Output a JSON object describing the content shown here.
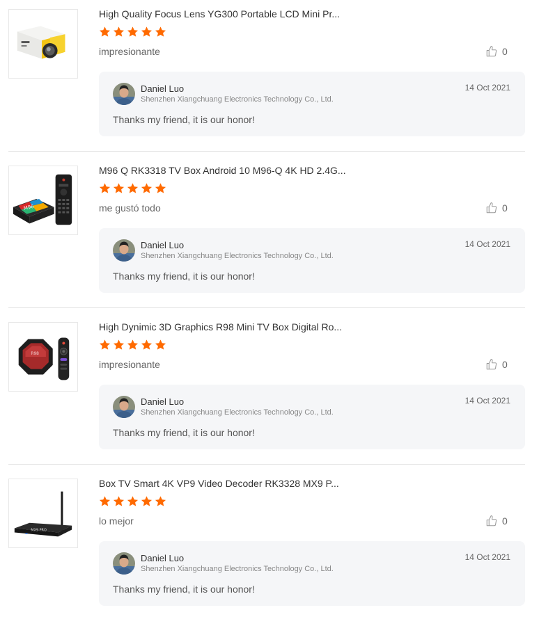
{
  "colors": {
    "star": "#ff6a00",
    "reply_bg": "#f5f6f8",
    "divider": "#e3e3e3"
  },
  "reviews": [
    {
      "product_title": "High Quality Focus Lens YG300 Portable LCD Mini Pr...",
      "rating": 5,
      "comment": "impresionante",
      "like_icon": "thumbs-up-icon",
      "like_count": "0",
      "reply": {
        "seller_name": "Daniel Luo",
        "seller_company": "Shenzhen Xiangchuang Electronics Technology Co., Ltd.",
        "date": "14 Oct 2021",
        "text": "Thanks my friend, it is our honor!"
      }
    },
    {
      "product_title": "M96 Q RK3318 TV Box Android 10 M96-Q 4K HD 2.4G...",
      "rating": 5,
      "comment": "me gustó todo",
      "like_icon": "thumbs-up-icon",
      "like_count": "0",
      "reply": {
        "seller_name": "Daniel Luo",
        "seller_company": "Shenzhen Xiangchuang Electronics Technology Co., Ltd.",
        "date": "14 Oct 2021",
        "text": "Thanks my friend, it is our honor!"
      }
    },
    {
      "product_title": "High Dynimic 3D Graphics R98 Mini TV Box Digital Ro...",
      "rating": 5,
      "comment": "impresionante",
      "like_icon": "thumbs-up-icon",
      "like_count": "0",
      "reply": {
        "seller_name": "Daniel Luo",
        "seller_company": "Shenzhen Xiangchuang Electronics Technology Co., Ltd.",
        "date": "14 Oct 2021",
        "text": "Thanks my friend, it is our honor!"
      }
    },
    {
      "product_title": "Box TV Smart 4K VP9 Video Decoder RK3328 MX9 P...",
      "rating": 5,
      "comment": "lo mejor",
      "like_icon": "thumbs-up-icon",
      "like_count": "0",
      "reply": {
        "seller_name": "Daniel Luo",
        "seller_company": "Shenzhen Xiangchuang Electronics Technology Co., Ltd.",
        "date": "14 Oct 2021",
        "text": "Thanks my friend, it is our honor!"
      }
    }
  ]
}
